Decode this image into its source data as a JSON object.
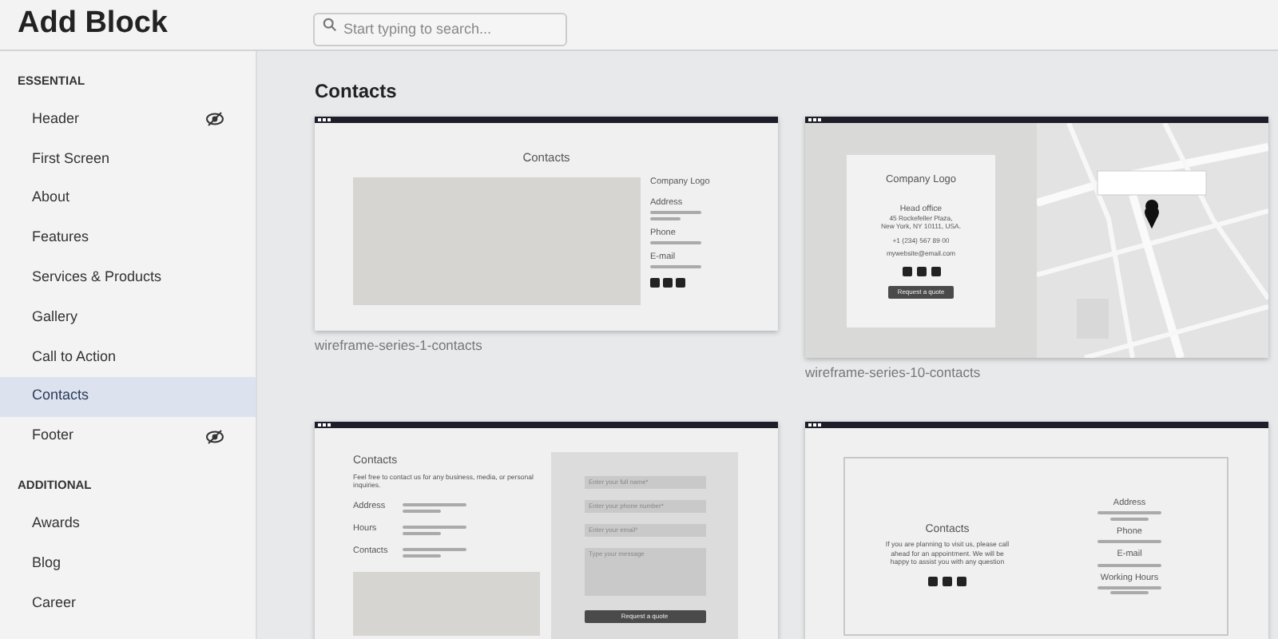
{
  "header": {
    "title": "Add Block",
    "search": {
      "placeholder": "Start typing to search..."
    }
  },
  "sidebar": {
    "sections": [
      {
        "heading": "ESSENTIAL",
        "items": [
          {
            "label": "Header",
            "selected": false,
            "hidden": true
          },
          {
            "label": "First Screen",
            "selected": false,
            "hidden": false
          },
          {
            "label": "About",
            "selected": false,
            "hidden": false
          },
          {
            "label": "Features",
            "selected": false,
            "hidden": false
          },
          {
            "label": "Services & Products",
            "selected": false,
            "hidden": false
          },
          {
            "label": "Gallery",
            "selected": false,
            "hidden": false
          },
          {
            "label": "Call to Action",
            "selected": false,
            "hidden": false
          },
          {
            "label": "Contacts",
            "selected": true,
            "hidden": false
          },
          {
            "label": "Footer",
            "selected": false,
            "hidden": true
          }
        ]
      },
      {
        "heading": "ADDITIONAL",
        "items": [
          {
            "label": "Awards",
            "selected": false,
            "hidden": false
          },
          {
            "label": "Blog",
            "selected": false,
            "hidden": false
          },
          {
            "label": "Career",
            "selected": false,
            "hidden": false
          }
        ]
      }
    ]
  },
  "content": {
    "heading": "Contacts",
    "blocks": [
      {
        "kind": "image-left",
        "caption": "wireframe-series-1-contacts",
        "title": "Contacts",
        "logo": "Company Logo",
        "fields": [
          "Address",
          "Phone",
          "E-mail"
        ]
      },
      {
        "kind": "map-right",
        "caption": "wireframe-series-10-contacts",
        "logo": "Company Logo",
        "lines": [
          "Head office",
          "45 Rockefeller Plaza,",
          "New York, NY 10111, USA.",
          "+1 (234) 567 89 00",
          "mywebsite@email.com"
        ],
        "button": "Request a quote"
      },
      {
        "kind": "form-right",
        "title": "Contacts",
        "intro": "Feel free to contact us for any business, media, or personal inquiries.",
        "fields": [
          "Address",
          "Hours",
          "Contacts"
        ],
        "inputs": [
          {
            "kind": "input",
            "placeholder": "Enter your full name*"
          },
          {
            "kind": "input",
            "placeholder": "Enter your phone number*"
          },
          {
            "kind": "input",
            "placeholder": "Enter your email*"
          },
          {
            "kind": "textarea",
            "placeholder": "Type your message"
          }
        ],
        "button": "Request a quote"
      },
      {
        "kind": "centered",
        "title": "Contacts",
        "intro": "If you are planning to visit us, please call ahead for an appointment. We will be happy to assist you with any question",
        "fields": [
          "Address",
          "Phone",
          "E-mail",
          "Working Hours"
        ]
      }
    ]
  }
}
